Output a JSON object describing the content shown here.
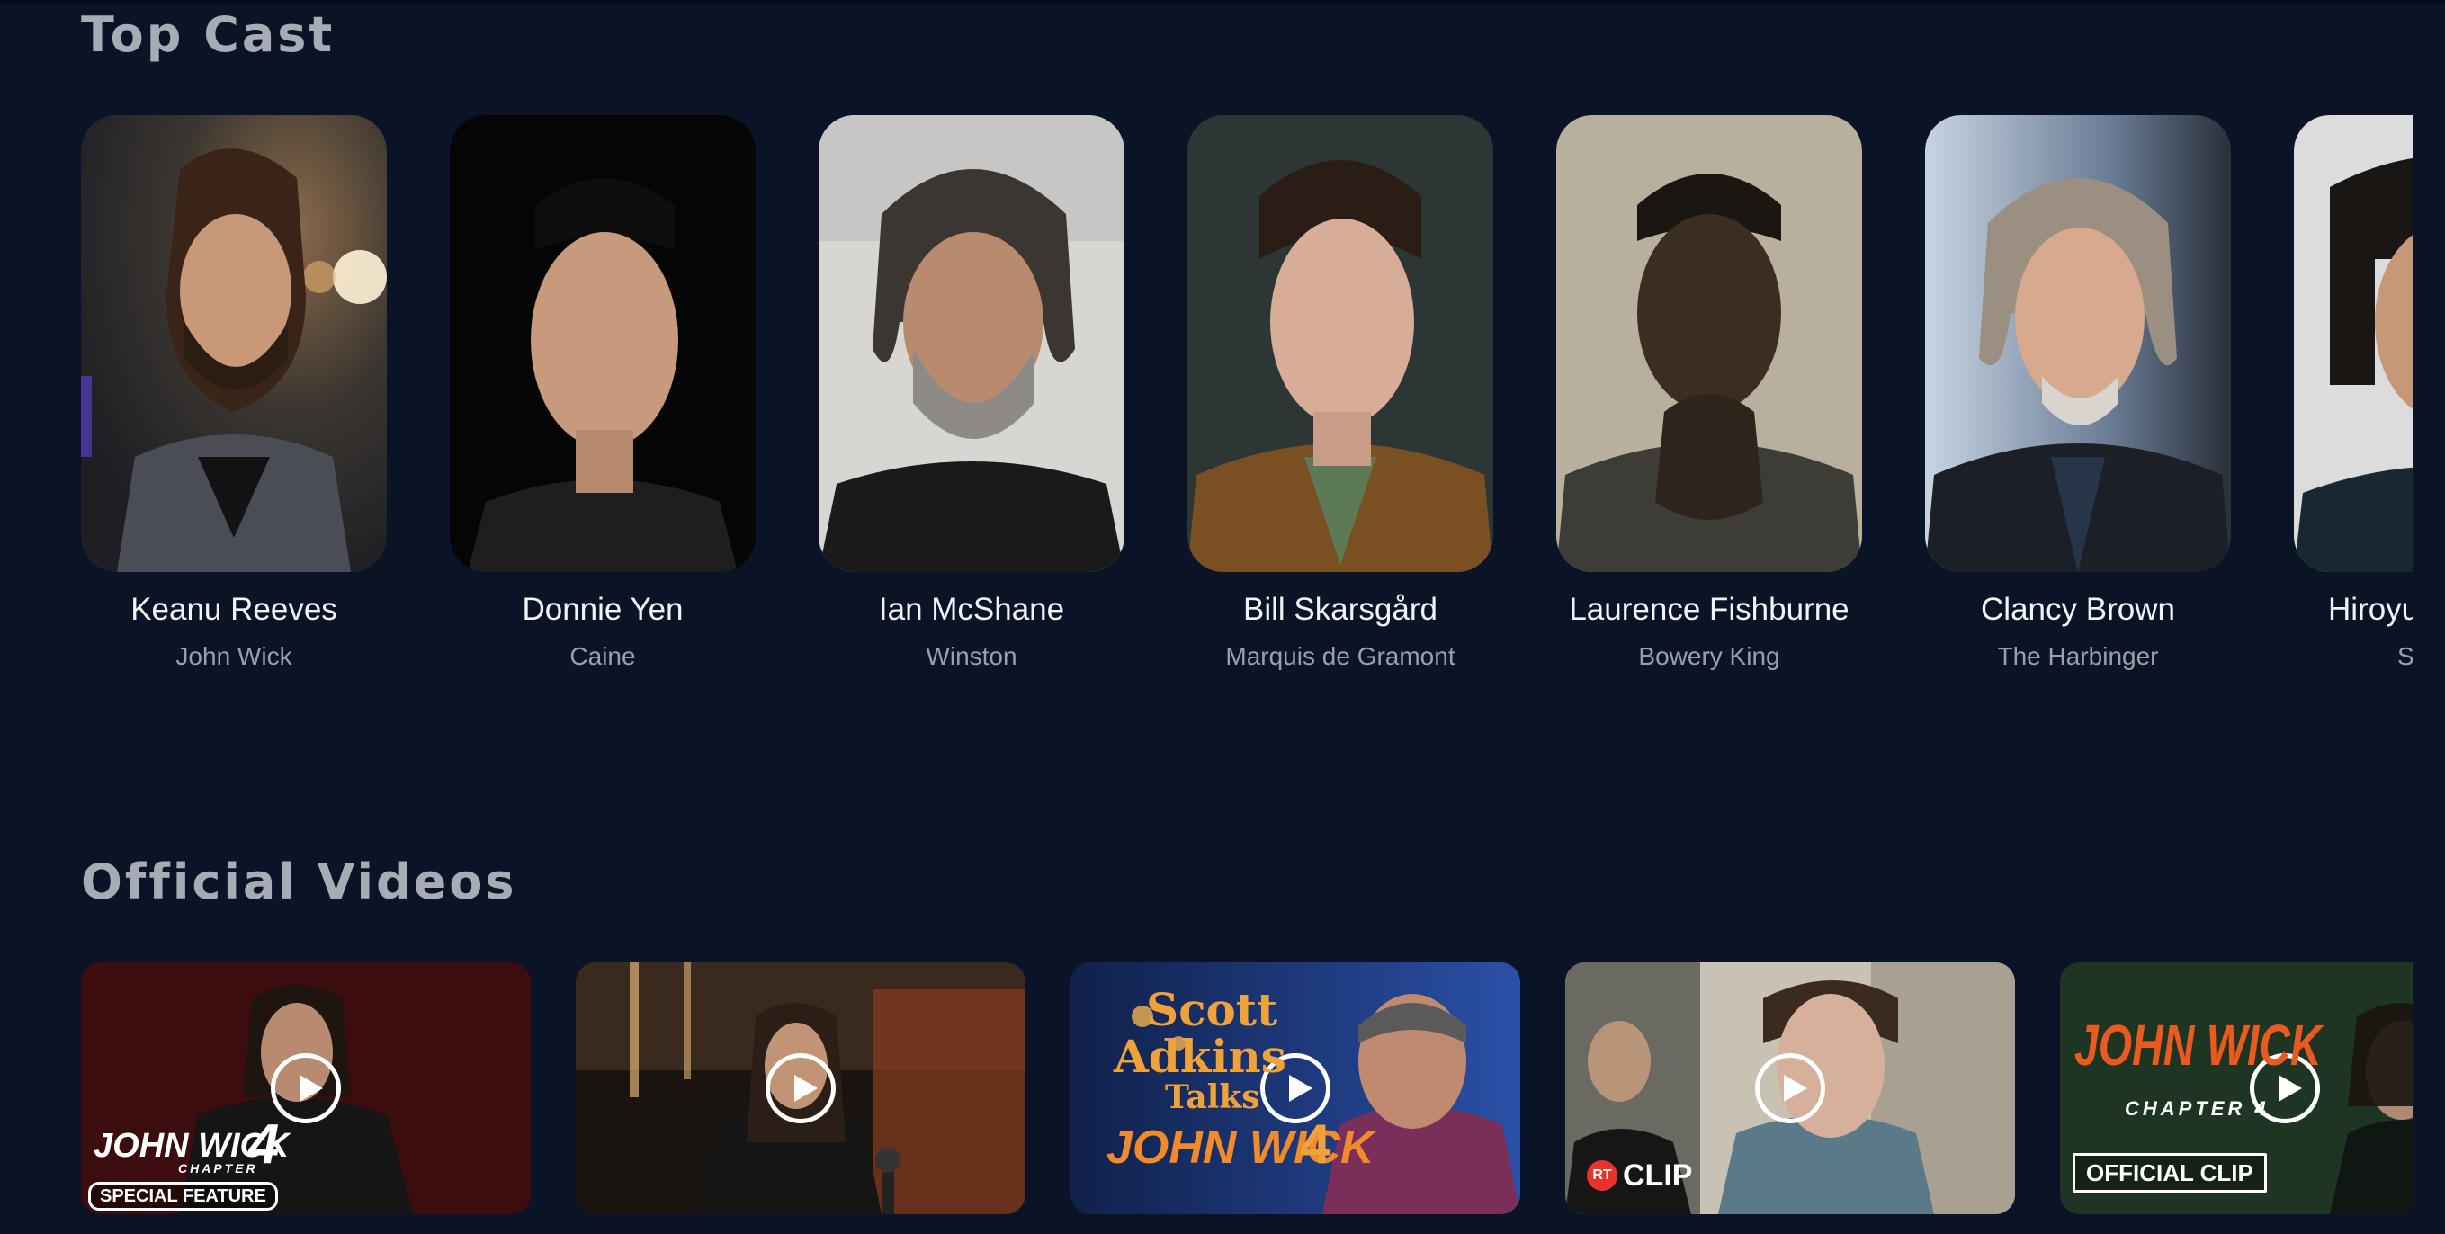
{
  "sections": {
    "cast_title": "Top Cast",
    "videos_title": "Official Videos"
  },
  "cast": [
    {
      "name": "Keanu Reeves",
      "role": "John Wick"
    },
    {
      "name": "Donnie Yen",
      "role": "Caine"
    },
    {
      "name": "Ian McShane",
      "role": "Winston"
    },
    {
      "name": "Bill Skarsgård",
      "role": "Marquis de Gramont"
    },
    {
      "name": "Laurence Fishburne",
      "role": "Bowery King"
    },
    {
      "name": "Clancy Brown",
      "role": "The Harbinger"
    },
    {
      "name": "Hiroyu",
      "role": "S"
    }
  ],
  "videos": [
    {
      "overlay_title": "JOHN WICK",
      "overlay_number": "4",
      "overlay_chapter": "CHAPTER",
      "badge": "SPECIAL FEATURE"
    },
    {},
    {
      "overlay_line1": "Scott",
      "overlay_line2": "Adkins",
      "overlay_line3": "Talks",
      "overlay_title": "JOHN WICK",
      "overlay_number": "4"
    },
    {
      "badge_prefix": "RT",
      "badge": "CLIP"
    },
    {
      "overlay_title": "JOHN WICK",
      "overlay_chapter": "CHAPTER 4",
      "badge": "OFFICIAL CLIP"
    }
  ],
  "colors": {
    "background": "#0b1426",
    "section_title": "#a6abb4",
    "cast_name": "#f2f3f5",
    "cast_role": "#9aa0a9",
    "accent_orange": "#f0a23a"
  },
  "icons": [
    "play-icon"
  ]
}
